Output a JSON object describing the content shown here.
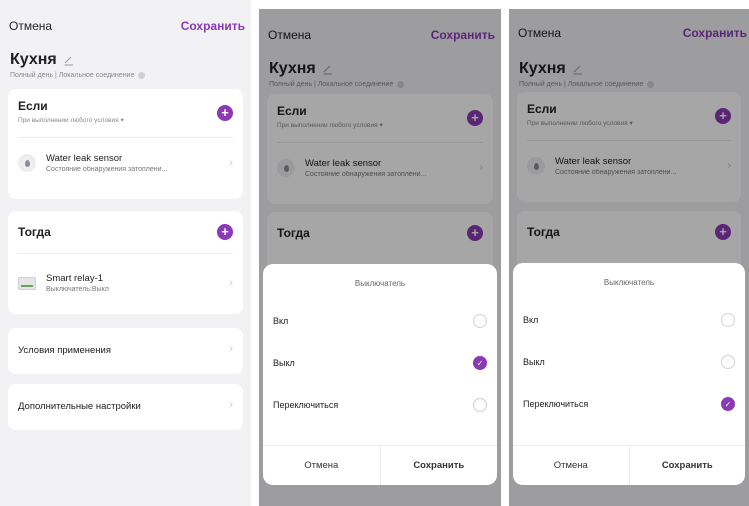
{
  "header": {
    "cancel": "Отмена",
    "save": "Сохранить"
  },
  "scene": {
    "title": "Кухня",
    "subtitle": "Полный день | Локальное соединение"
  },
  "if_card": {
    "title": "Если",
    "subtitle": "При выполнении любого условия ▾",
    "device": {
      "name": "Water leak sensor",
      "status": "Состояние обнаружения затоплени..."
    }
  },
  "then_card": {
    "title": "Тогда",
    "device": {
      "name": "Smart relay-1",
      "status": "Выключатель:Выкл"
    }
  },
  "conditions_label": "Условия применения",
  "advanced_label": "Дополнительные настройки",
  "sheet": {
    "title": "Выключатель",
    "options": [
      "Вкл",
      "Выкл",
      "Переключиться"
    ],
    "cancel": "Отмена",
    "save": "Сохранить"
  },
  "colors": {
    "accent": "#8a3ab4"
  },
  "icons": {
    "plus": "+",
    "check": "✓",
    "chevron": "›"
  }
}
